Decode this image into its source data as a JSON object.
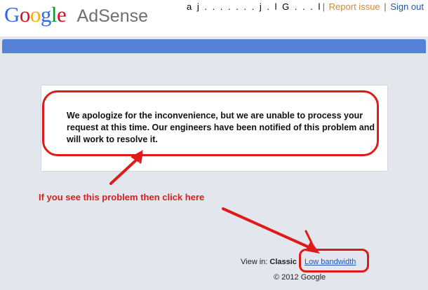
{
  "header": {
    "logo": {
      "letters": [
        {
          "char": "G",
          "color": "#3369e8"
        },
        {
          "char": "o",
          "color": "#d50f25"
        },
        {
          "char": "o",
          "color": "#eeb211"
        },
        {
          "char": "g",
          "color": "#3369e8"
        },
        {
          "char": "l",
          "color": "#009925"
        },
        {
          "char": "e",
          "color": "#d50f25"
        }
      ],
      "product": "AdSense"
    },
    "account_email": "a j . . . . . . . j . l G . . . l",
    "links": {
      "separator": "|",
      "report_issue": "Report issue",
      "sign_out": "Sign out"
    }
  },
  "error_message": "We apologize for the inconvenience, but we are unable to process your request at this time. Our engineers have been notified of this problem and will work to resolve it.",
  "annotation": "If you see this problem then click here",
  "footer": {
    "view_in_label": "View in:",
    "view_classic": "Classic",
    "low_bandwidth": "Low bandwidth",
    "copyright": "© 2012 Google"
  },
  "colors": {
    "header_bar": "#5582d6",
    "annotation_red": "#dd1b1b",
    "link_orange": "#d18b2e",
    "link_blue": "#2255bb"
  }
}
